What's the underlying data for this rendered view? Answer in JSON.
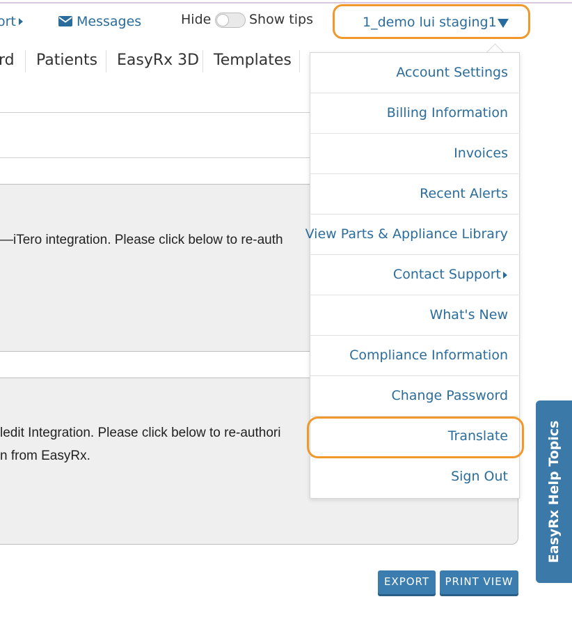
{
  "topbar": {
    "support_partial": "ort",
    "messages_label": "Messages",
    "hide_label": "Hide",
    "show_tips_label": "Show tips",
    "account_name": "1_demo lui staging1"
  },
  "nav": {
    "tabs": [
      "rd",
      "Patients",
      "EasyRx 3D",
      "Templates"
    ]
  },
  "content": {
    "itero_text": "—iTero integration. Please click below to re-auth",
    "medit_line1": "ledit Integration. Please click below to re-authori",
    "medit_line2": "n from EasyRx."
  },
  "dropdown": {
    "items": [
      "Account Settings",
      "Billing Information",
      "Invoices",
      "Recent Alerts",
      "View Parts & Appliance Library",
      "Contact Support",
      "What's New",
      "Compliance Information",
      "Change Password",
      "Translate",
      "Sign Out"
    ]
  },
  "help_tab": {
    "label": "EasyRx Help Topics"
  },
  "buttons": {
    "export": "EXPORT",
    "print_view": "PRINT VIEW"
  },
  "colors": {
    "link": "#2a6c9b",
    "highlight": "#f0982b",
    "button": "#3b7dae"
  }
}
